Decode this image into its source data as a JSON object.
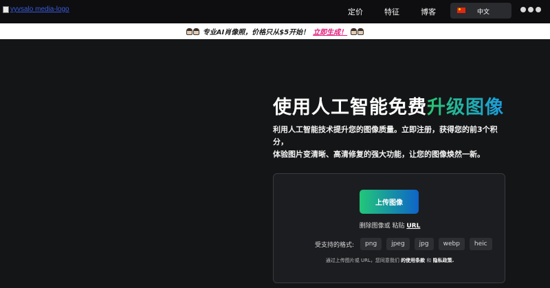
{
  "header": {
    "logo_alt": "vyvsalo media-logo",
    "nav": [
      {
        "label": "定价"
      },
      {
        "label": "特征"
      },
      {
        "label": "博客"
      }
    ],
    "language": {
      "label": "中文",
      "flag": "china-flag-icon"
    }
  },
  "banner": {
    "text": "专业AI肖像照，价格只从$5开始！",
    "cta": "立即生成！"
  },
  "hero": {
    "title_plain": "使用人工智能免费",
    "title_highlight": "升级图像",
    "subtitle_line1": "利用人工智能技术提升您的图像质量。立即注册，获得您的前3个积分，",
    "subtitle_line2": "体验图片变清晰、高清修复的强大功能，让您的图像焕然一新。"
  },
  "upload": {
    "button_label": "上传图像",
    "paste_prefix": "删除图像或 粘贴",
    "paste_url": "URL",
    "formats_label": "受支持的格式:",
    "formats": [
      "png",
      "jpeg",
      "jpg",
      "webp",
      "heic"
    ],
    "terms_prefix": "通过上传图片或 URL，您同意我们",
    "terms_link": "的使用条款",
    "terms_and": "和",
    "privacy_link": "隐私政策."
  },
  "colors": {
    "accent_green": "#28c76f",
    "accent_blue": "#1a9be0",
    "cta_pink": "#e0197a",
    "background": "#141517"
  }
}
